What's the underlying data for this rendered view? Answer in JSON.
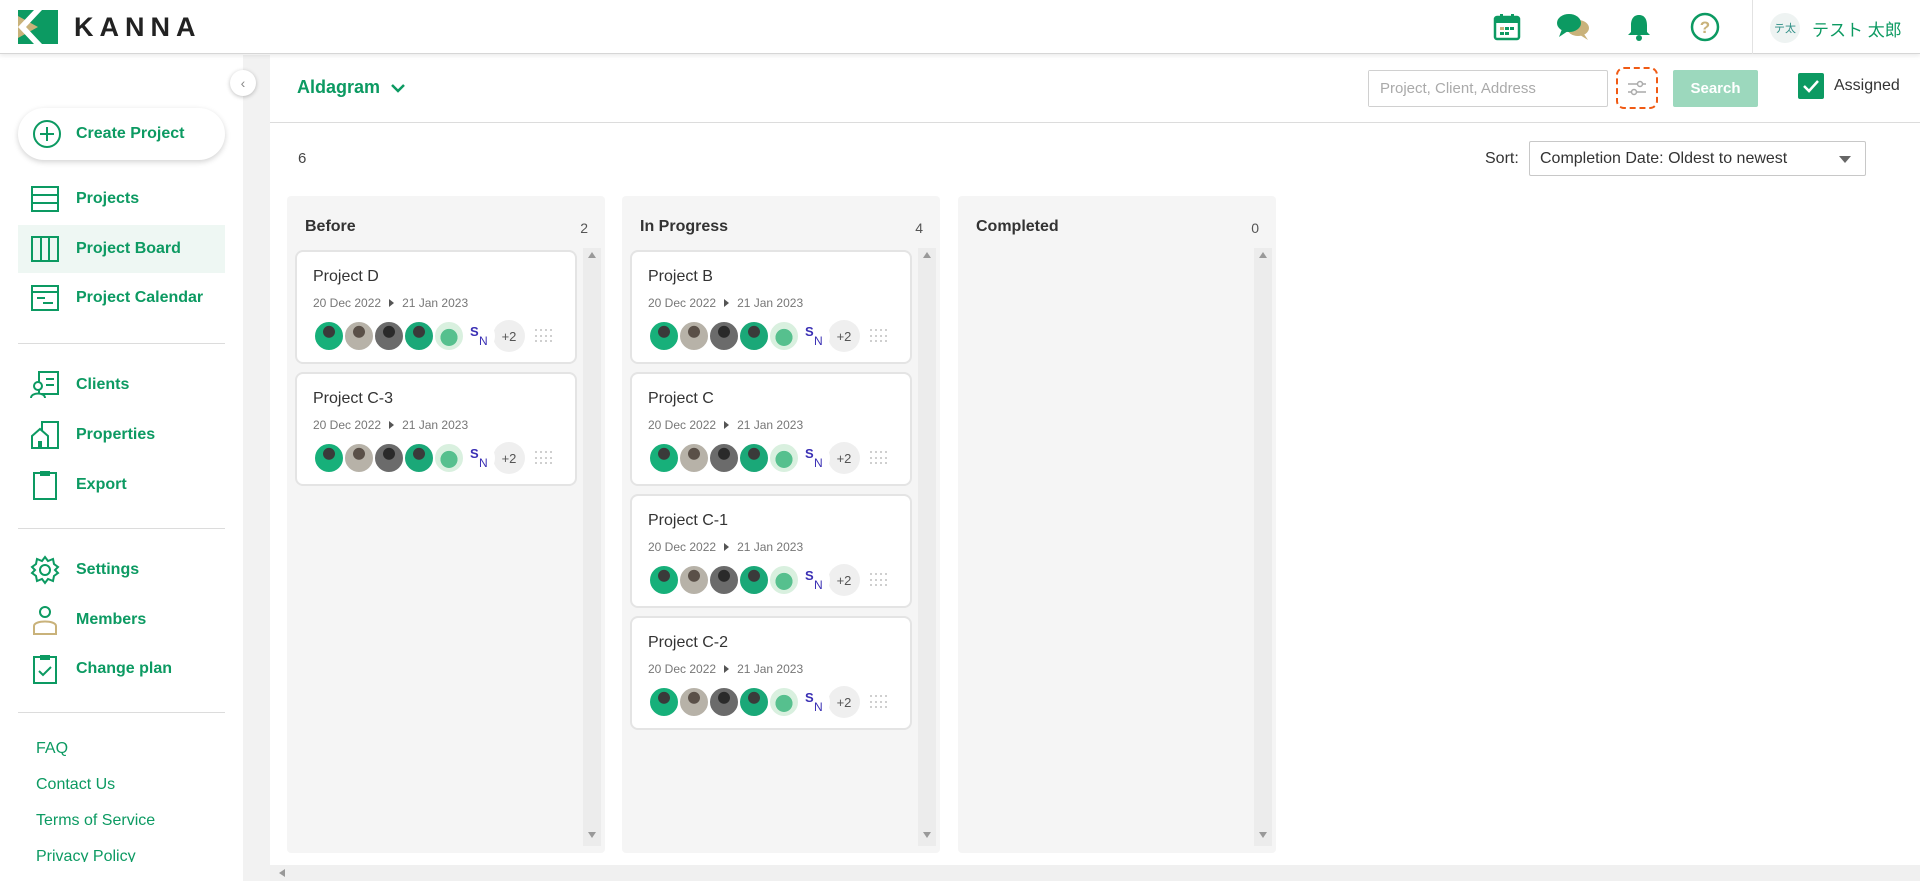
{
  "brand": {
    "name": "KANNA"
  },
  "user": {
    "initials": "テ太",
    "name": "テスト 太郎"
  },
  "sidebar": {
    "create_label": "Create Project",
    "items": [
      {
        "label": "Projects"
      },
      {
        "label": "Project Board"
      },
      {
        "label": "Project Calendar"
      },
      {
        "label": "Clients"
      },
      {
        "label": "Properties"
      },
      {
        "label": "Export"
      },
      {
        "label": "Settings"
      },
      {
        "label": "Members"
      },
      {
        "label": "Change plan"
      }
    ],
    "footer": [
      "FAQ",
      "Contact Us",
      "Terms of Service",
      "Privacy Policy"
    ]
  },
  "header": {
    "company": "Aldagram",
    "search_placeholder": "Project, Client, Address",
    "search_label": "Search",
    "assigned_label": "Assigned",
    "assigned_checked": true
  },
  "board": {
    "total_count": "6",
    "sort_label": "Sort:",
    "sort_value": "Completion Date: Oldest to newest",
    "columns": [
      {
        "title": "Before",
        "count": "2",
        "cards": [
          {
            "title": "Project D",
            "start": "20 Dec 2022",
            "end": "21 Jan 2023",
            "more": "+2"
          },
          {
            "title": "Project C-3",
            "start": "20 Dec 2022",
            "end": "21 Jan 2023",
            "more": "+2"
          }
        ]
      },
      {
        "title": "In Progress",
        "count": "4",
        "cards": [
          {
            "title": "Project B",
            "start": "20 Dec 2022",
            "end": "21 Jan 2023",
            "more": "+2"
          },
          {
            "title": "Project C",
            "start": "20 Dec 2022",
            "end": "21 Jan 2023",
            "more": "+2"
          },
          {
            "title": "Project C-1",
            "start": "20 Dec 2022",
            "end": "21 Jan 2023",
            "more": "+2"
          },
          {
            "title": "Project C-2",
            "start": "20 Dec 2022",
            "end": "21 Jan 2023",
            "more": "+2"
          }
        ]
      },
      {
        "title": "Completed",
        "count": "0",
        "cards": []
      }
    ]
  },
  "avatar_initials": {
    "s": "S",
    "n": "N"
  },
  "colors": {
    "brand_green": "#0c9a62",
    "filter_highlight": "#f05a14",
    "search_button": "#9cd8bd"
  }
}
